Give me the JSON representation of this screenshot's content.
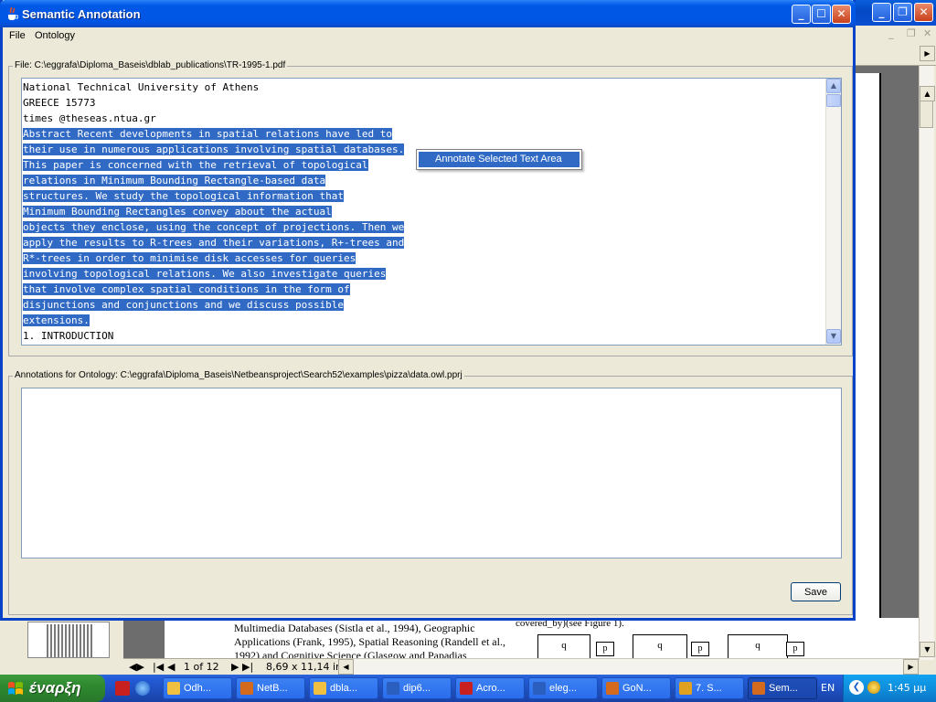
{
  "app": {
    "title": "Semantic Annotation",
    "menu": [
      "File",
      "Ontology"
    ],
    "file_label": "File:  C:\\eggrafa\\Diploma_Baseis\\dblab_publications\\TR-1995-1.pdf",
    "annotations_label": "Annotations for Ontology:  C:\\eggrafa\\Diploma_Baseis\\Netbeansproject\\Search52\\examples\\pizza\\data.owl.pprj",
    "text_lines": [
      {
        "text": "National Technical University of Athens",
        "selected": false
      },
      {
        "text": "GREECE 15773",
        "selected": false
      },
      {
        "text": "times @theseas.ntua.gr",
        "selected": false
      },
      {
        "text": "Abstract Recent developments in spatial relations have led to",
        "selected": true
      },
      {
        "text": "their use in numerous applications involving spatial databases.",
        "selected": true
      },
      {
        "text": "This paper is concerned with the retrieval of topological",
        "selected": true
      },
      {
        "text": "relations in Minimum Bounding Rectangle-based data",
        "selected": true
      },
      {
        "text": "structures. We study the topological information that",
        "selected": true
      },
      {
        "text": "Minimum Bounding Rectangles convey about the actual",
        "selected": true
      },
      {
        "text": "objects they enclose, using the concept of projections. Then we",
        "selected": true
      },
      {
        "text": "apply the results to R-trees and their variations, R+-trees and",
        "selected": true
      },
      {
        "text": "R*-trees in order to minimise disk accesses for queries",
        "selected": true
      },
      {
        "text": "involving topological relations. We also investigate queries",
        "selected": true
      },
      {
        "text": "that involve complex spatial conditions in the form of",
        "selected": true
      },
      {
        "text": "disjunctions and conjunctions and we discuss possible",
        "selected": true
      },
      {
        "text": "extensions.",
        "selected": true
      },
      {
        "text": "1. INTRODUCTION",
        "selected": false
      }
    ],
    "context_menu_item": "Annotate Selected Text Area",
    "save_label": "Save"
  },
  "background": {
    "page_text_left": "Multimedia Databases (Sistla et al., 1994), Geographic Applications (Frank, 1995), Spatial Reasoning (Randell et al., 1992) and Cognitive Science (Glasgow and Papadias",
    "page_text_right": "covered_by)(see Figure 1).",
    "figure_labels": [
      "q",
      "p",
      "q",
      "p",
      "q",
      "p"
    ],
    "page_indicator": "1 of 12",
    "page_size": "8,69 x 11,14 in"
  },
  "taskbar": {
    "start_label": "έναρξη",
    "tasks": [
      {
        "label": "Odh...",
        "icon_color": "#f0c040"
      },
      {
        "label": "NetB...",
        "icon_color": "#d46a1e"
      },
      {
        "label": "dbla...",
        "icon_color": "#f0c040"
      },
      {
        "label": "dip6...",
        "icon_color": "#2b5fbf"
      },
      {
        "label": "Acro...",
        "icon_color": "#c8201e"
      },
      {
        "label": "eleg...",
        "icon_color": "#2b5fbf"
      },
      {
        "label": "GoN...",
        "icon_color": "#d46a1e"
      },
      {
        "label": "7. S...",
        "icon_color": "#e0a020"
      },
      {
        "label": "Sem...",
        "icon_color": "#d46a1e",
        "active": true
      }
    ],
    "language": "EN",
    "clock": "1:45 μμ"
  }
}
